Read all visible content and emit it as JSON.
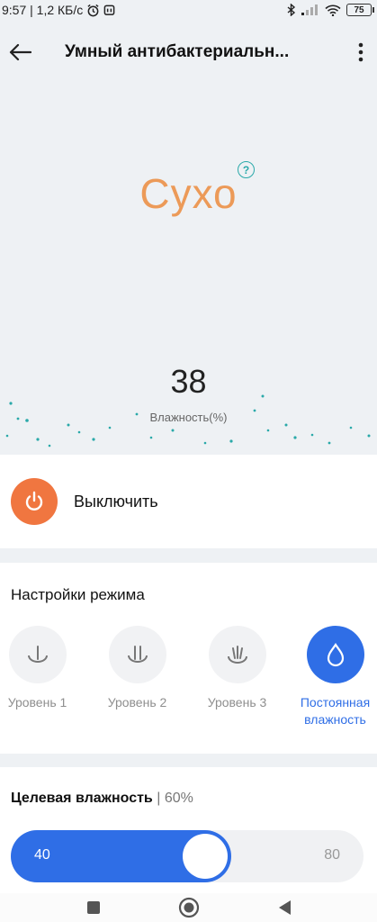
{
  "status_bar": {
    "time_speed": "9:57 | 1,2 КБ/с",
    "battery": "75"
  },
  "header": {
    "title": "Умный антибактериальн..."
  },
  "hero": {
    "status": "Сухо",
    "help": "?",
    "humidity_value": "38",
    "humidity_label": "Влажность(%)"
  },
  "power": {
    "label": "Выключить"
  },
  "mode_settings": {
    "title": "Настройки режима",
    "modes": [
      {
        "label": "Уровень 1",
        "active": false
      },
      {
        "label": "Уровень 2",
        "active": false
      },
      {
        "label": "Уровень 3",
        "active": false
      },
      {
        "label": "Постоянная влажность",
        "active": true
      }
    ]
  },
  "target_humidity": {
    "title": "Целевая влажность",
    "value_text": "60%",
    "min": "40",
    "max": "80",
    "value": 60,
    "range": [
      40,
      80
    ]
  },
  "colors": {
    "accent": "#2f6ee6",
    "status": "#ec9a58",
    "power": "#f07640",
    "dots": "#2aa9a9"
  }
}
